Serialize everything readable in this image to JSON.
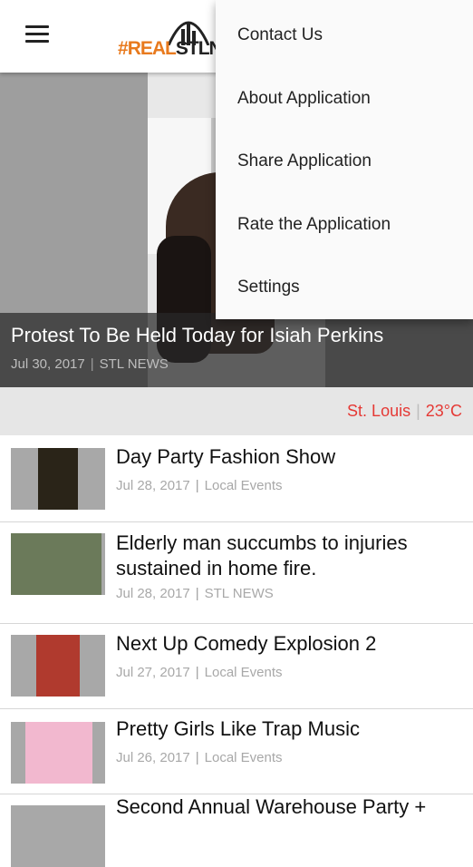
{
  "appbar": {
    "logo_text_hash": "#",
    "logo_text_real": "REAL",
    "logo_text_stl": "STLNEWS"
  },
  "hero": {
    "title": "Protest To Be Held Today for Isiah Perkins",
    "date": "Jul 30, 2017",
    "category": "STL NEWS"
  },
  "weather": {
    "city": "St. Louis",
    "temp": "23°C"
  },
  "articles": [
    {
      "title": "Day Party Fashion Show",
      "date": "Jul 28, 2017",
      "category": "Local Events"
    },
    {
      "title": "Elderly man succumbs to injuries sustained in home fire.",
      "date": "Jul 28, 2017",
      "category": "STL NEWS"
    },
    {
      "title": "Next Up Comedy Explosion 2",
      "date": "Jul 27, 2017",
      "category": "Local Events"
    },
    {
      "title": "Pretty Girls Like Trap Music",
      "date": "Jul 26, 2017",
      "category": "Local Events"
    },
    {
      "title": "Second Annual Warehouse Party +",
      "date": "",
      "category": ""
    }
  ],
  "menu": {
    "items": [
      "Contact Us",
      "About Application",
      "Share Application",
      "Rate the Application",
      "Settings"
    ]
  },
  "colors": {
    "accent": "#e53935",
    "brand_orange": "#e87a1e"
  }
}
